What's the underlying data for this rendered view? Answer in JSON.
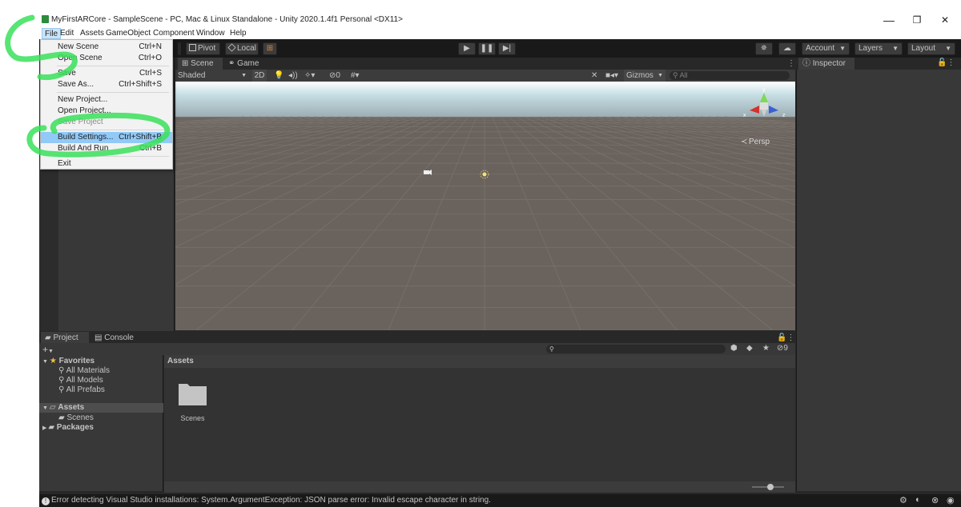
{
  "window": {
    "title": "MyFirstARCore - SampleScene - PC, Mac & Linux Standalone - Unity 2020.1.4f1 Personal <DX11>",
    "minimize": "—",
    "maximize": "❐",
    "close": "✕"
  },
  "menubar": [
    "File",
    "Edit",
    "Assets",
    "GameObject",
    "Component",
    "Window",
    "Help"
  ],
  "file_menu": [
    {
      "label": "New Scene",
      "shortcut": "Ctrl+N"
    },
    {
      "label": "Open Scene",
      "shortcut": "Ctrl+O"
    },
    {
      "label": "Save",
      "shortcut": "Ctrl+S"
    },
    {
      "label": "Save As...",
      "shortcut": "Ctrl+Shift+S"
    },
    {
      "label": "New Project...",
      "shortcut": ""
    },
    {
      "label": "Open Project...",
      "shortcut": ""
    },
    {
      "label": "Save Project",
      "shortcut": ""
    },
    {
      "label": "Build Settings...",
      "shortcut": "Ctrl+Shift+B"
    },
    {
      "label": "Build And Run",
      "shortcut": "Ctrl+B"
    },
    {
      "label": "Exit",
      "shortcut": ""
    }
  ],
  "toolbar": {
    "pivot": "Pivot",
    "local": "Local",
    "account": "Account",
    "layers": "Layers",
    "layout": "Layout"
  },
  "scene_tabs": [
    "Scene",
    "Game"
  ],
  "scene_toolbar": {
    "shading": "Shaded",
    "mode_2d": "2D",
    "hidden_count": "0",
    "gizmos": "Gizmos",
    "search_placeholder": "All",
    "persp": "Persp"
  },
  "inspector": {
    "tab": "Inspector"
  },
  "project": {
    "tabs": [
      "Project",
      "Console"
    ],
    "add": "+",
    "hidden_count": "9",
    "favorites": "Favorites",
    "favorite_items": [
      "All Materials",
      "All Models",
      "All Prefabs"
    ],
    "assets_root": "Assets",
    "assets_children": [
      "Scenes"
    ],
    "packages": "Packages",
    "assets_header": "Assets",
    "folder_label": "Scenes"
  },
  "statusbar": {
    "message": "Error detecting Visual Studio installations: System.ArgumentException: JSON parse error: Invalid escape character in string."
  },
  "colors": {
    "editor_dark": "#191919",
    "panel": "#383838",
    "menu_highlight": "#91c9f7",
    "annotation": "#39e05a"
  }
}
